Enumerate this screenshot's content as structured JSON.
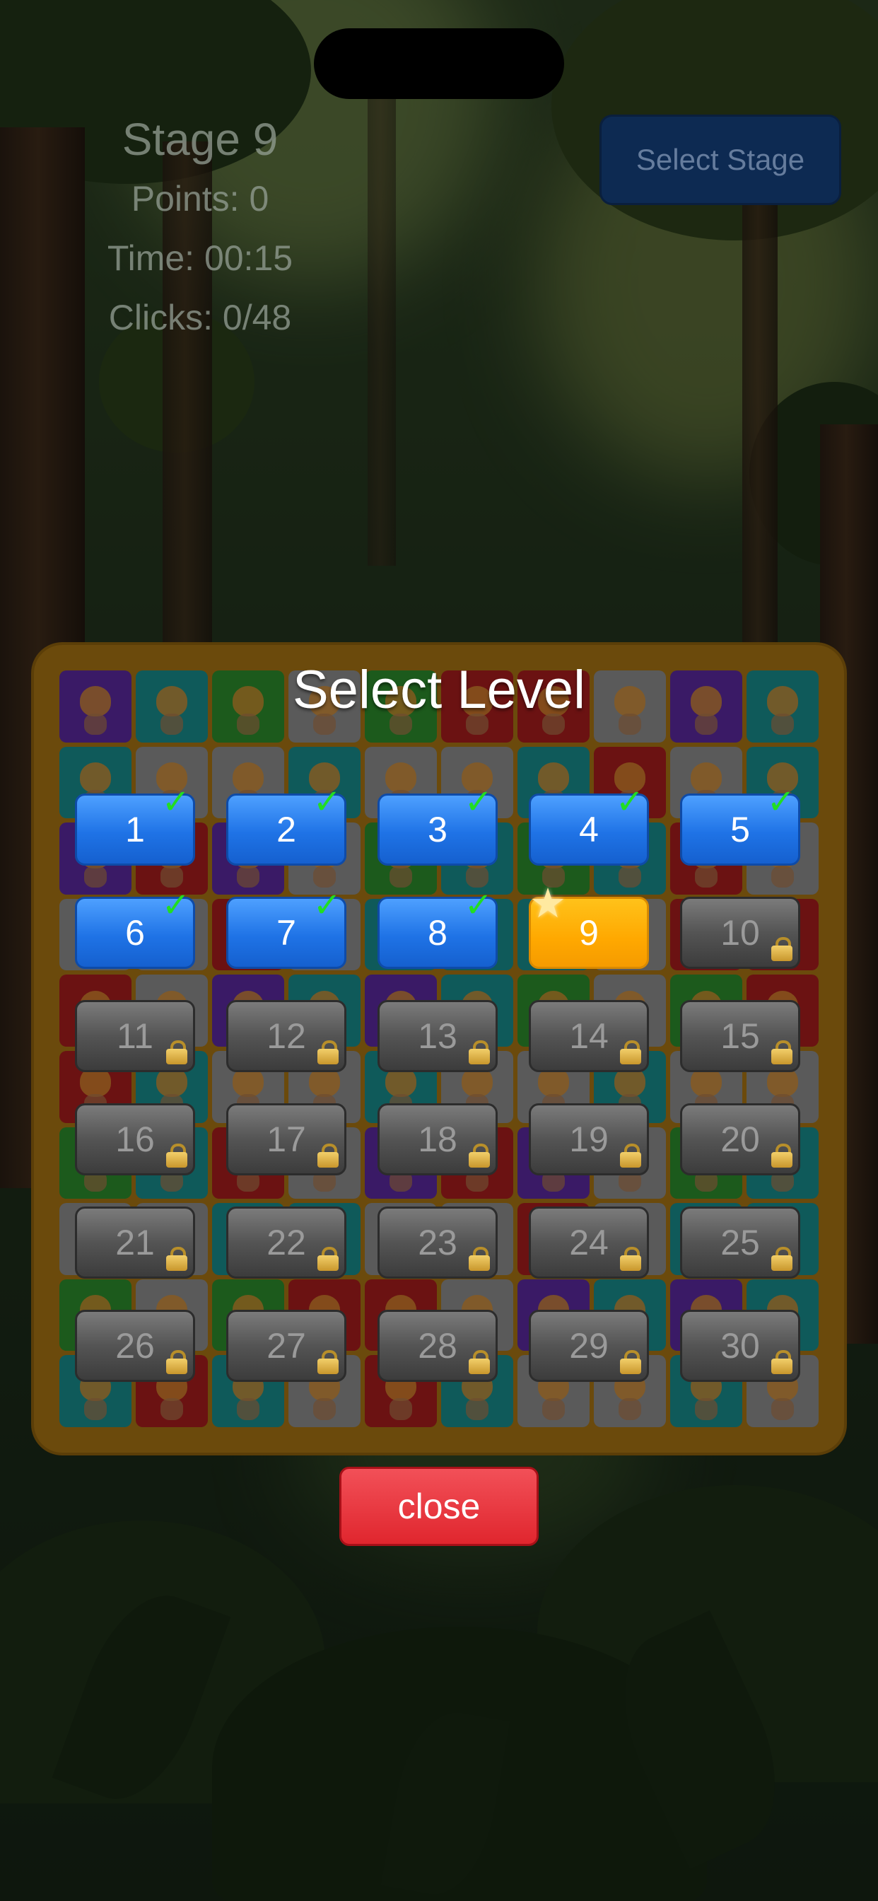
{
  "hud": {
    "stage": "Stage 9",
    "points": "Points: 0",
    "time": "Time: 00:15",
    "clicks": "Clicks: 0/48",
    "select_stage_label": "Select Stage"
  },
  "level_select": {
    "title": "Select Level",
    "close_label": "close",
    "current_level": 9,
    "levels": [
      {
        "label": "1",
        "state": "completed"
      },
      {
        "label": "2",
        "state": "completed"
      },
      {
        "label": "3",
        "state": "completed"
      },
      {
        "label": "4",
        "state": "completed"
      },
      {
        "label": "5",
        "state": "completed"
      },
      {
        "label": "6",
        "state": "completed"
      },
      {
        "label": "7",
        "state": "completed"
      },
      {
        "label": "8",
        "state": "completed"
      },
      {
        "label": "9",
        "state": "current"
      },
      {
        "label": "10",
        "state": "locked"
      },
      {
        "label": "11",
        "state": "locked"
      },
      {
        "label": "12",
        "state": "locked"
      },
      {
        "label": "13",
        "state": "locked"
      },
      {
        "label": "14",
        "state": "locked"
      },
      {
        "label": "15",
        "state": "locked"
      },
      {
        "label": "16",
        "state": "locked"
      },
      {
        "label": "17",
        "state": "locked"
      },
      {
        "label": "18",
        "state": "locked"
      },
      {
        "label": "19",
        "state": "locked"
      },
      {
        "label": "20",
        "state": "locked"
      },
      {
        "label": "21",
        "state": "locked"
      },
      {
        "label": "22",
        "state": "locked"
      },
      {
        "label": "23",
        "state": "locked"
      },
      {
        "label": "24",
        "state": "locked"
      },
      {
        "label": "25",
        "state": "locked"
      },
      {
        "label": "26",
        "state": "locked"
      },
      {
        "label": "27",
        "state": "locked"
      },
      {
        "label": "28",
        "state": "locked"
      },
      {
        "label": "29",
        "state": "locked"
      },
      {
        "label": "30",
        "state": "locked"
      }
    ]
  },
  "board_tile_colors": [
    "#3a1a66",
    "#5a5a5a",
    "#6b1212",
    "#0f5a5a",
    "#1c5a1c",
    "#6b1212",
    "#3a1a66",
    "#0f5a5a",
    "#1c5a1c",
    "#5a5a5a"
  ],
  "colors": {
    "completed": "#1f73e6",
    "current": "#ffa800",
    "locked": "#545454",
    "check": "#22dd22",
    "close": "#e0262e",
    "panel": "#6b4a0c"
  }
}
